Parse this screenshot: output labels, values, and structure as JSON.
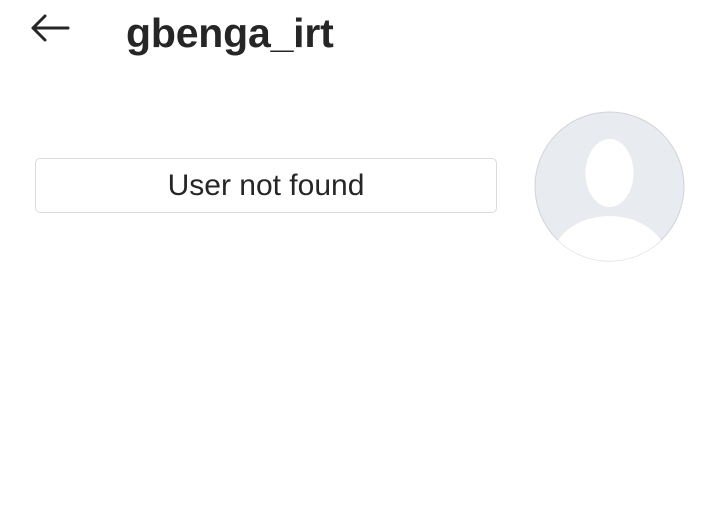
{
  "header": {
    "back_icon": "arrow-left-icon",
    "username": "gbenga_irt"
  },
  "profile": {
    "status_text": "User not found",
    "avatar_icon": "default-avatar-icon"
  },
  "colors": {
    "text": "#262626",
    "border": "#dbdbdb",
    "avatar_bg": "#e8ebef",
    "avatar_silhouette": "#ffffff"
  }
}
